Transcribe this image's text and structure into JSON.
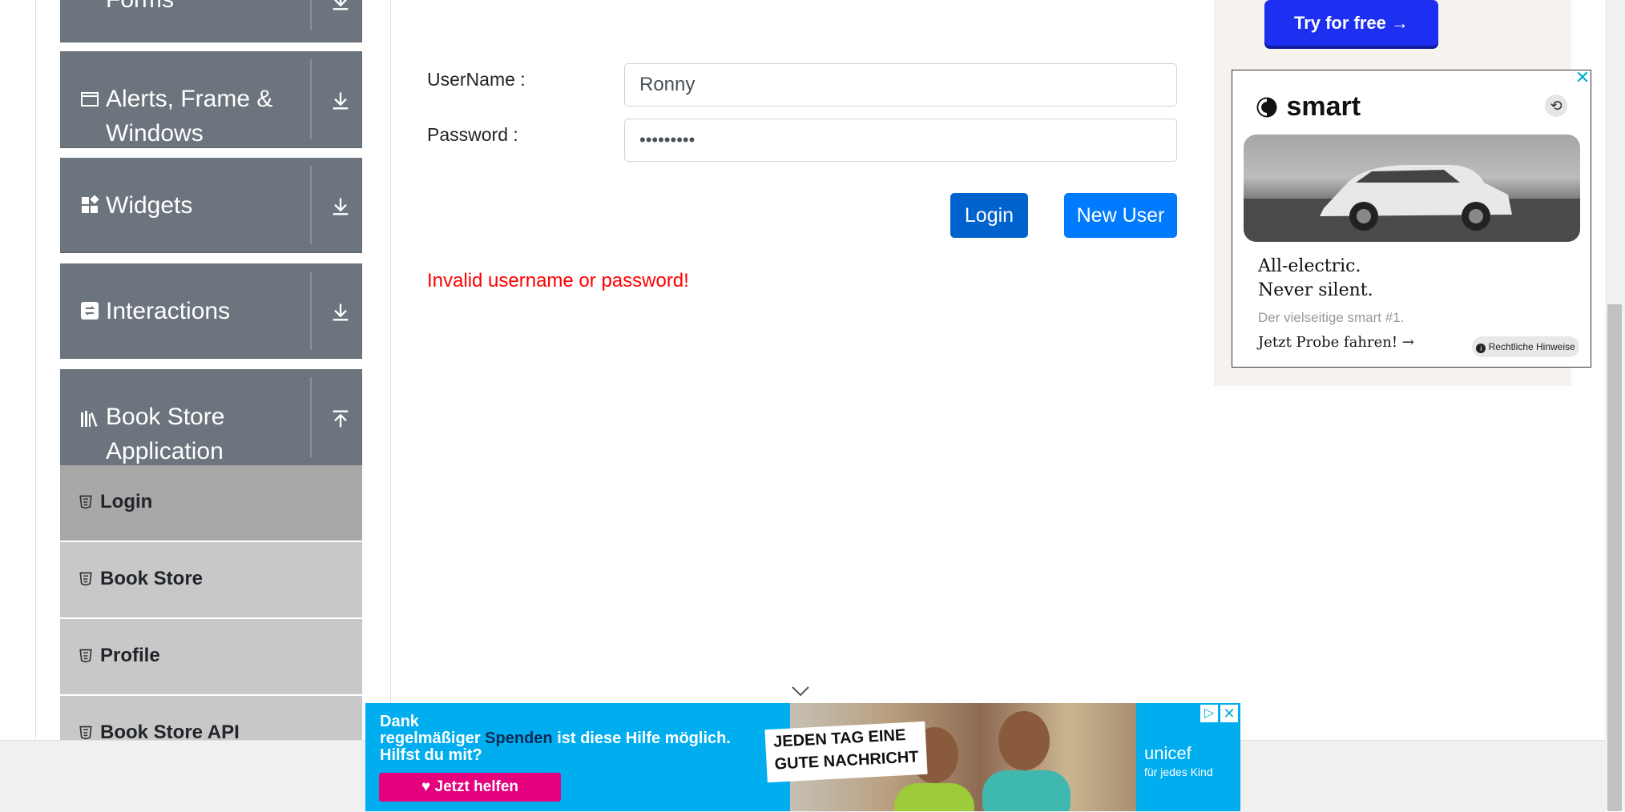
{
  "sidebar": {
    "groups": [
      {
        "label": "Forms",
        "expanded": false
      },
      {
        "label_line1": "Alerts, Frame &",
        "label_line2": "Windows",
        "expanded": false
      },
      {
        "label": "Widgets",
        "expanded": false
      },
      {
        "label": "Interactions",
        "expanded": false
      },
      {
        "label_line1": "Book Store",
        "label_line2": "Application",
        "expanded": true
      }
    ],
    "bookstore_items": [
      {
        "label": "Login",
        "active": true
      },
      {
        "label": "Book Store",
        "active": false
      },
      {
        "label": "Profile",
        "active": false
      },
      {
        "label": "Book Store API",
        "active": false
      }
    ]
  },
  "login_form": {
    "username_label": "UserName :",
    "username_value": "Ronny",
    "password_label": "Password :",
    "password_value": "•••••••••",
    "login_button": "Login",
    "new_user_button": "New User",
    "error_message": "Invalid username or password!"
  },
  "ads": {
    "top_ad": {
      "cta": "Try for free →"
    },
    "smart_ad": {
      "brand": "smart",
      "headline_1": "All-electric.",
      "headline_2": "Never silent.",
      "subline": "Der vielseitige smart #1.",
      "cta": "Jetzt Probe fahren! →",
      "legal": "Rechtliche Hinweise",
      "close": "✕"
    },
    "unicef_ad": {
      "line1": "Dank",
      "line2_a": "regelmäßiger",
      "line2_b": "Spenden",
      "line2_c": "ist diese Hilfe möglich.",
      "line3": "Hilfst du mit?",
      "button": "♥ Jetzt helfen",
      "news_1": "JEDEN TAG EINE",
      "news_2": "GUTE NACHRICHT",
      "brand": "unicef",
      "brand_sub": "für jedes Kind",
      "adchoice": "▷",
      "close": "✕"
    }
  },
  "colors": {
    "group_bg": "#6c757d",
    "login_btn": "#0062cc",
    "new_user_btn": "#007bff",
    "error": "#ff0000",
    "unicef_blue": "#00aeef",
    "unicef_pink": "#e5007e"
  }
}
